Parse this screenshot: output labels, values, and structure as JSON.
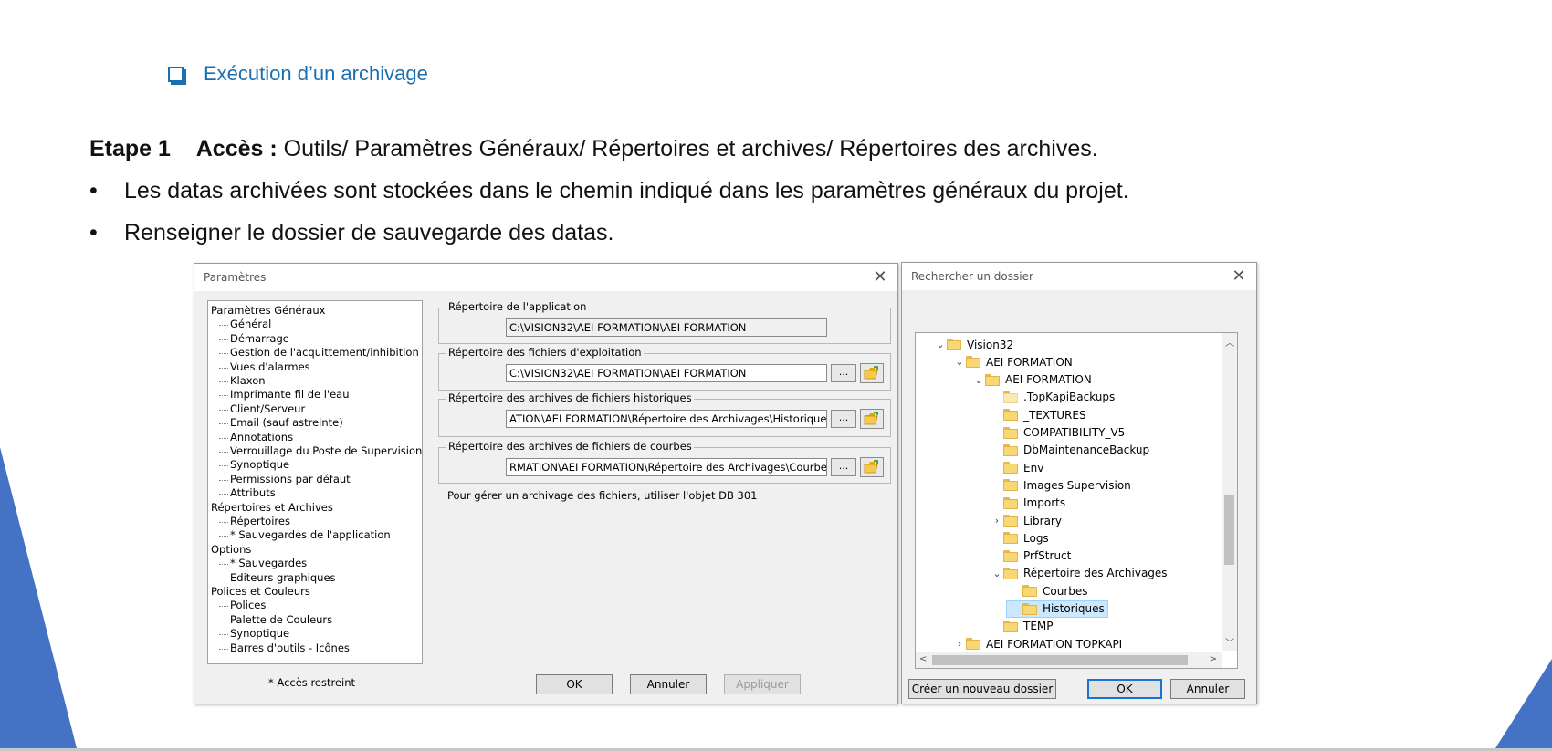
{
  "slide": {
    "section_title": "Exécution d’un archivage",
    "step_label": "Etape 1",
    "access_label": "Accès :",
    "access_path": "Outils/ Paramètres Généraux/ Répertoires et archives/ Répertoires des archives.",
    "bullets": [
      "Les datas archivées sont stockées dans le chemin indiqué dans les paramètres généraux du projet.",
      "Renseigner le dossier de sauvegarde des datas."
    ],
    "bullet_char": "•",
    "accent_color": "#4472c4",
    "title_color": "#1a6fb0"
  },
  "params_dialog": {
    "title": "Paramètres",
    "tree": [
      {
        "label": "Paramètres Généraux",
        "level": 0
      },
      {
        "label": "Général",
        "level": 1
      },
      {
        "label": "Démarrage",
        "level": 1
      },
      {
        "label": "Gestion de l'acquittement/inhibition",
        "level": 1
      },
      {
        "label": "Vues d'alarmes",
        "level": 1
      },
      {
        "label": "Klaxon",
        "level": 1
      },
      {
        "label": "Imprimante fil de l'eau",
        "level": 1
      },
      {
        "label": "Client/Serveur",
        "level": 1
      },
      {
        "label": "Email (sauf astreinte)",
        "level": 1
      },
      {
        "label": "Annotations",
        "level": 1
      },
      {
        "label": "Verrouillage du Poste de Supervision",
        "level": 1
      },
      {
        "label": "Synoptique",
        "level": 1
      },
      {
        "label": "Permissions par défaut",
        "level": 1
      },
      {
        "label": "Attributs",
        "level": 1
      },
      {
        "label": "Répertoires et Archives",
        "level": 0
      },
      {
        "label": "Répertoires",
        "level": 1
      },
      {
        "label": "* Sauvegardes de l'application",
        "level": 1
      },
      {
        "label": "Options",
        "level": 0
      },
      {
        "label": "* Sauvegardes",
        "level": 1
      },
      {
        "label": "Editeurs graphiques",
        "level": 1
      },
      {
        "label": "Polices et Couleurs",
        "level": 0
      },
      {
        "label": "Polices",
        "level": 1
      },
      {
        "label": "Palette de Couleurs",
        "level": 1
      },
      {
        "label": "Synoptique",
        "level": 1
      },
      {
        "label": "Barres d'outils - Icônes",
        "level": 1
      }
    ],
    "groups": {
      "app_dir": {
        "label": "Répertoire de l'application",
        "value": "C:\\VISION32\\AEI FORMATION\\AEI FORMATION"
      },
      "exploit_dir": {
        "label": "Répertoire des fichiers d'exploitation",
        "value": "C:\\VISION32\\AEI FORMATION\\AEI FORMATION"
      },
      "hist_dir": {
        "label": "Répertoire des archives de fichiers historiques",
        "value": "ATION\\AEI FORMATION\\Répertoire des Archivages\\Historiques"
      },
      "curves_dir": {
        "label": "Répertoire des archives de fichiers de courbes",
        "value": "RMATION\\AEI FORMATION\\Répertoire des Archivages\\Courbes"
      }
    },
    "browse_label": "...",
    "hint": "Pour gérer un archivage des fichiers, utiliser l'objet DB 301",
    "restricted_note": "* Accès restreint",
    "ok_label": "OK",
    "cancel_label": "Annuler",
    "apply_label": "Appliquer"
  },
  "browse_dialog": {
    "title": "Rechercher un dossier",
    "folders": [
      {
        "label": "Vision32",
        "level": 0,
        "expander": "open"
      },
      {
        "label": "AEI FORMATION",
        "level": 1,
        "expander": "open"
      },
      {
        "label": "AEI FORMATION",
        "level": 2,
        "expander": "open"
      },
      {
        "label": ".TopKapiBackups",
        "level": 3,
        "expander": "none",
        "faded": true
      },
      {
        "label": "_TEXTURES",
        "level": 3,
        "expander": "none"
      },
      {
        "label": "COMPATIBILITY_V5",
        "level": 3,
        "expander": "none"
      },
      {
        "label": "DbMaintenanceBackup",
        "level": 3,
        "expander": "none"
      },
      {
        "label": "Env",
        "level": 3,
        "expander": "none"
      },
      {
        "label": "Images Supervision",
        "level": 3,
        "expander": "none"
      },
      {
        "label": "Imports",
        "level": 3,
        "expander": "none"
      },
      {
        "label": "Library",
        "level": 3,
        "expander": "closed"
      },
      {
        "label": "Logs",
        "level": 3,
        "expander": "none"
      },
      {
        "label": "PrfStruct",
        "level": 3,
        "expander": "none"
      },
      {
        "label": "Répertoire des Archivages",
        "level": 3,
        "expander": "open"
      },
      {
        "label": "Courbes",
        "level": 4,
        "expander": "none"
      },
      {
        "label": "Historiques",
        "level": 4,
        "expander": "none",
        "selected": true
      },
      {
        "label": "TEMP",
        "level": 3,
        "expander": "none"
      },
      {
        "label": "AEI FORMATION TOPKAPI",
        "level": 1,
        "expander": "closed"
      }
    ],
    "new_folder_label": "Créer un nouveau dossier",
    "ok_label": "OK",
    "cancel_label": "Annuler"
  }
}
